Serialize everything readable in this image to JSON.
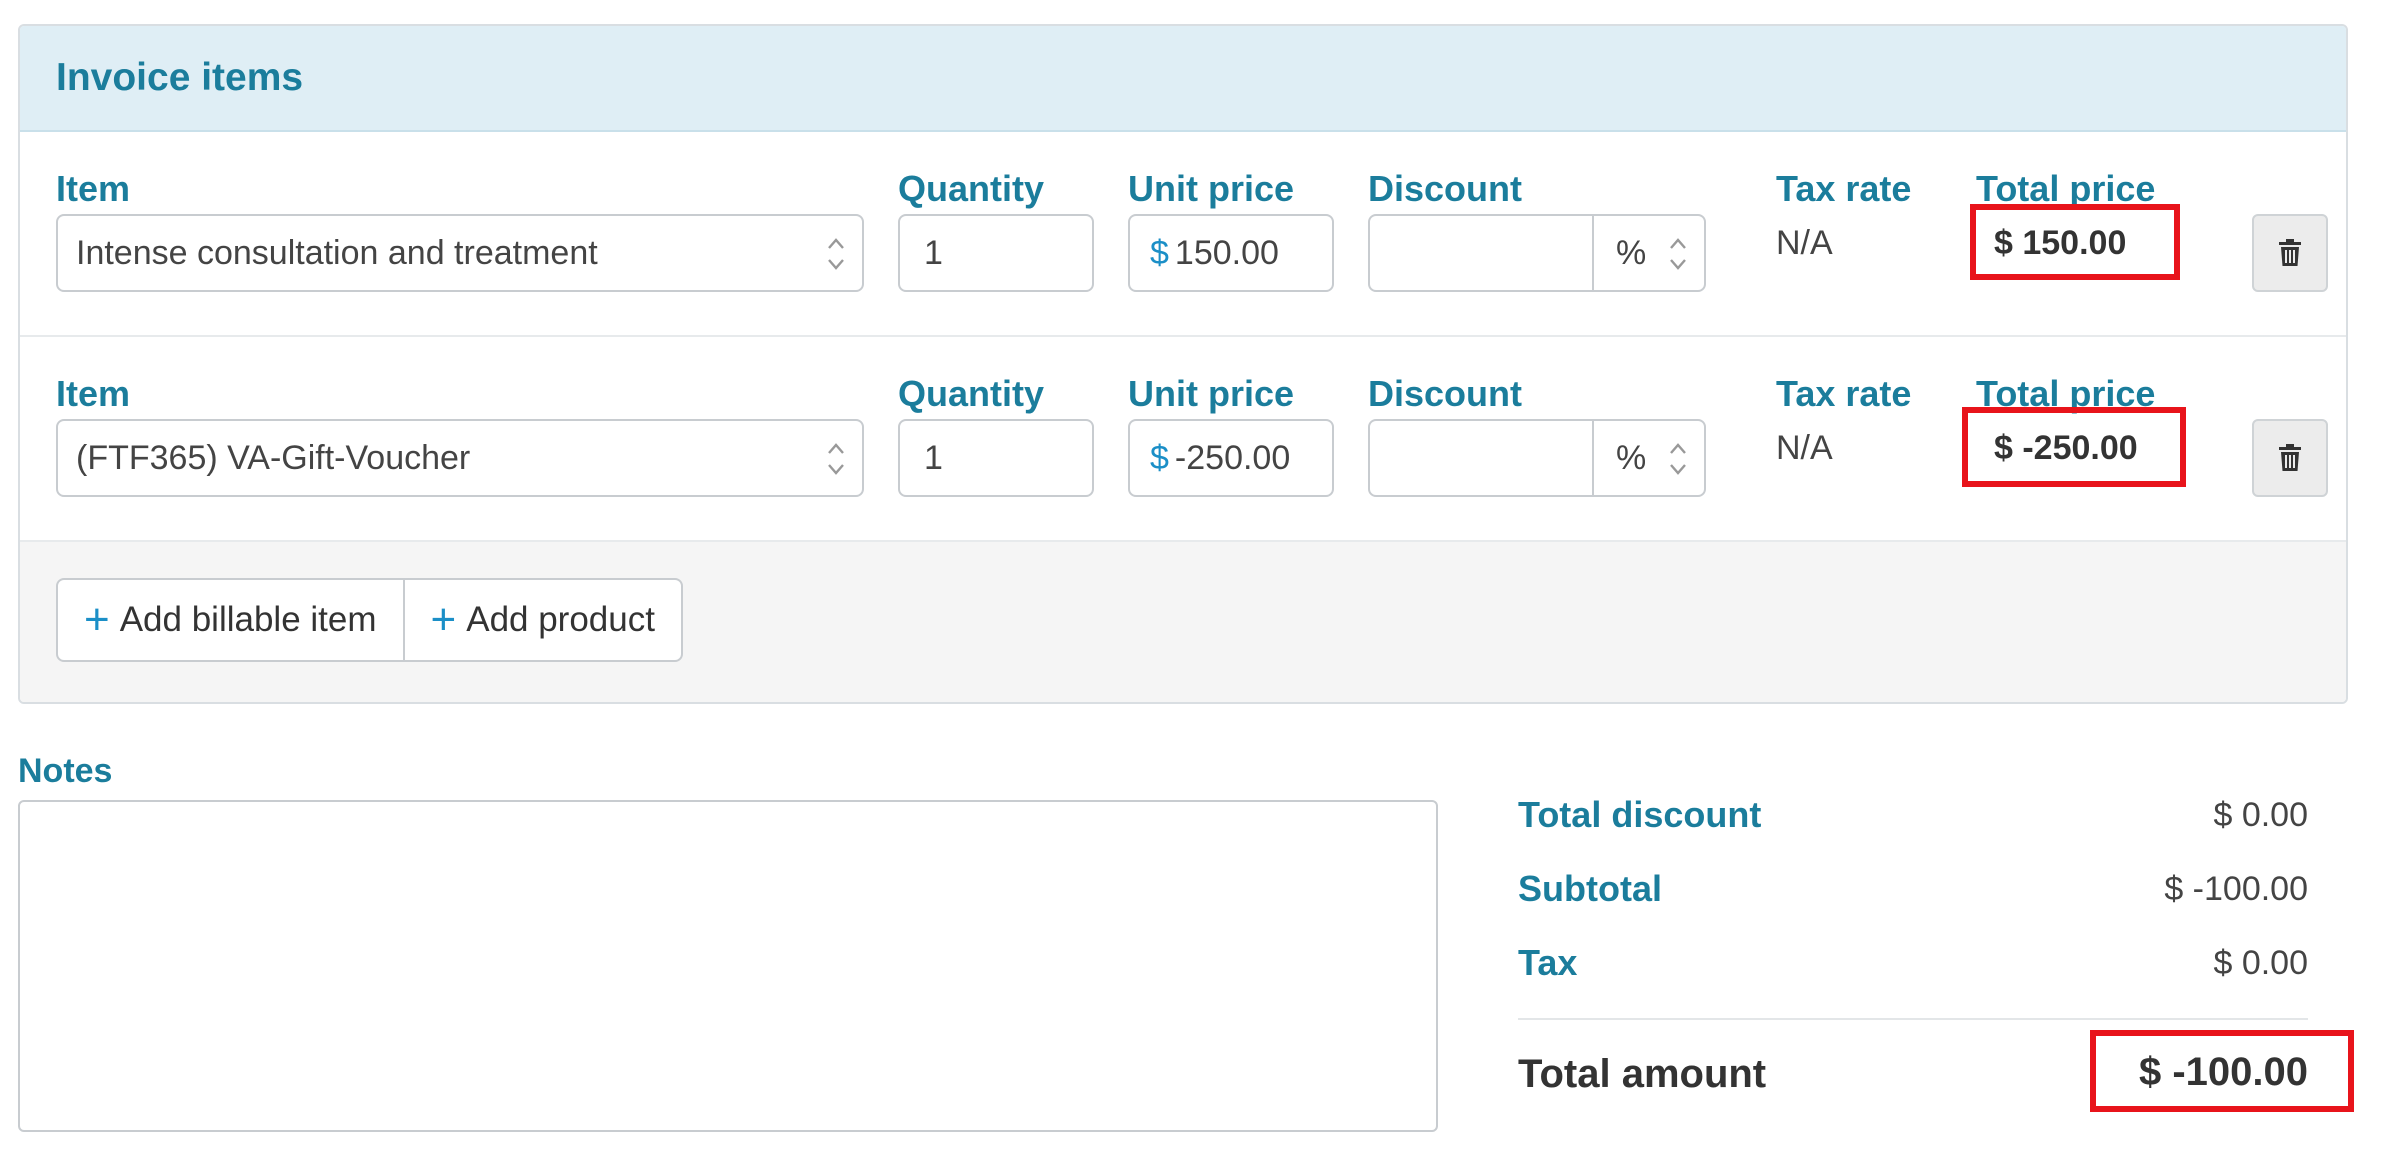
{
  "card": {
    "title": "Invoice items"
  },
  "columns": {
    "item": "Item",
    "quantity": "Quantity",
    "unit_price": "Unit price",
    "discount": "Discount",
    "tax_rate": "Tax rate",
    "total_price": "Total price"
  },
  "currency_symbol": "$",
  "percent_symbol": "%",
  "rows": [
    {
      "item": "Intense consultation and treatment",
      "quantity": "1",
      "unit_price": "150.00",
      "discount": "",
      "tax_rate": "N/A",
      "total_price": "$ 150.00"
    },
    {
      "item": "(FTF365) VA-Gift-Voucher",
      "quantity": "1",
      "unit_price": "-250.00",
      "discount": "",
      "tax_rate": "N/A",
      "total_price": "$ -250.00"
    }
  ],
  "actions": {
    "add_billable_item": "Add billable item",
    "add_product": "Add product"
  },
  "notes": {
    "label": "Notes",
    "value": ""
  },
  "summary": {
    "total_discount_label": "Total discount",
    "total_discount": "$ 0.00",
    "subtotal_label": "Subtotal",
    "subtotal": "$ -100.00",
    "tax_label": "Tax",
    "tax": "$ 0.00",
    "total_amount_label": "Total amount",
    "total_amount": "$ -100.00"
  },
  "icons": {
    "trash": "trash-icon",
    "plus": "plus-icon",
    "updown": "select-arrows-icon"
  },
  "colors": {
    "accent": "#1b7d9c",
    "header_bg": "#dfeef5",
    "highlight": "#e8141b",
    "currency": "#1b8fc7"
  }
}
